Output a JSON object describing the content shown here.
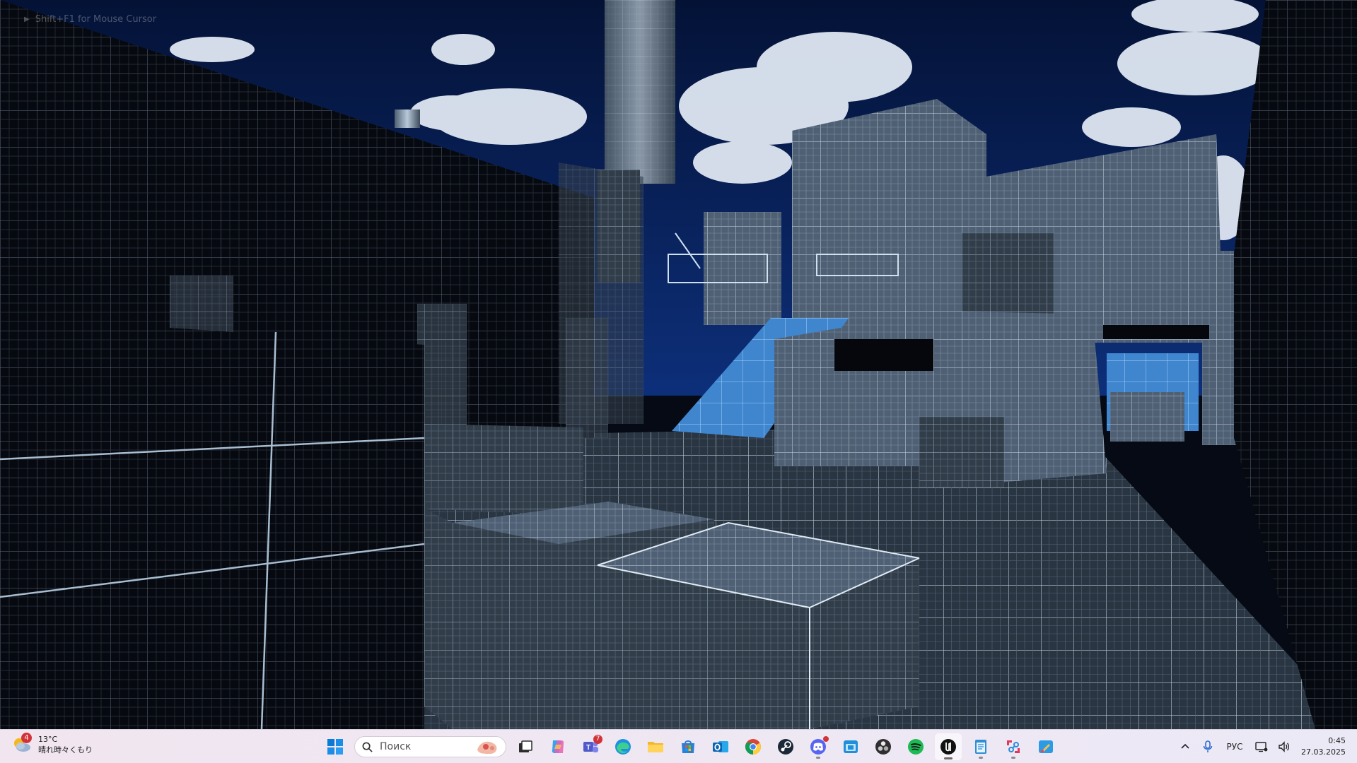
{
  "overlay": {
    "hint": "Shift+F1 for Mouse Cursor"
  },
  "taskbar": {
    "weather": {
      "temp": "13°C",
      "condition": "晴れ時々くもり",
      "badge": "4"
    },
    "search": {
      "placeholder": "Поиск"
    },
    "apps": [
      {
        "name": "task-view",
        "badge": ""
      },
      {
        "name": "copilot",
        "badge": ""
      },
      {
        "name": "teams",
        "badge": "7"
      },
      {
        "name": "edge",
        "badge": ""
      },
      {
        "name": "file-explorer",
        "badge": ""
      },
      {
        "name": "microsoft-store",
        "badge": ""
      },
      {
        "name": "outlook",
        "badge": ""
      },
      {
        "name": "chrome",
        "badge": ""
      },
      {
        "name": "steam",
        "badge": ""
      },
      {
        "name": "discord",
        "badge": ""
      },
      {
        "name": "app-blue",
        "badge": ""
      },
      {
        "name": "obs",
        "badge": ""
      },
      {
        "name": "spotify",
        "badge": ""
      },
      {
        "name": "unreal-engine",
        "badge": ""
      },
      {
        "name": "notepad",
        "badge": ""
      },
      {
        "name": "snipping-tool",
        "badge": ""
      },
      {
        "name": "paint",
        "badge": ""
      }
    ],
    "tray": {
      "language": "РУС",
      "time": "0:45",
      "date": "27.03.2025"
    }
  },
  "colors": {
    "sky": "#061a4a",
    "grid_line": "#cfe0f0",
    "highlight": "#4a90d6"
  }
}
